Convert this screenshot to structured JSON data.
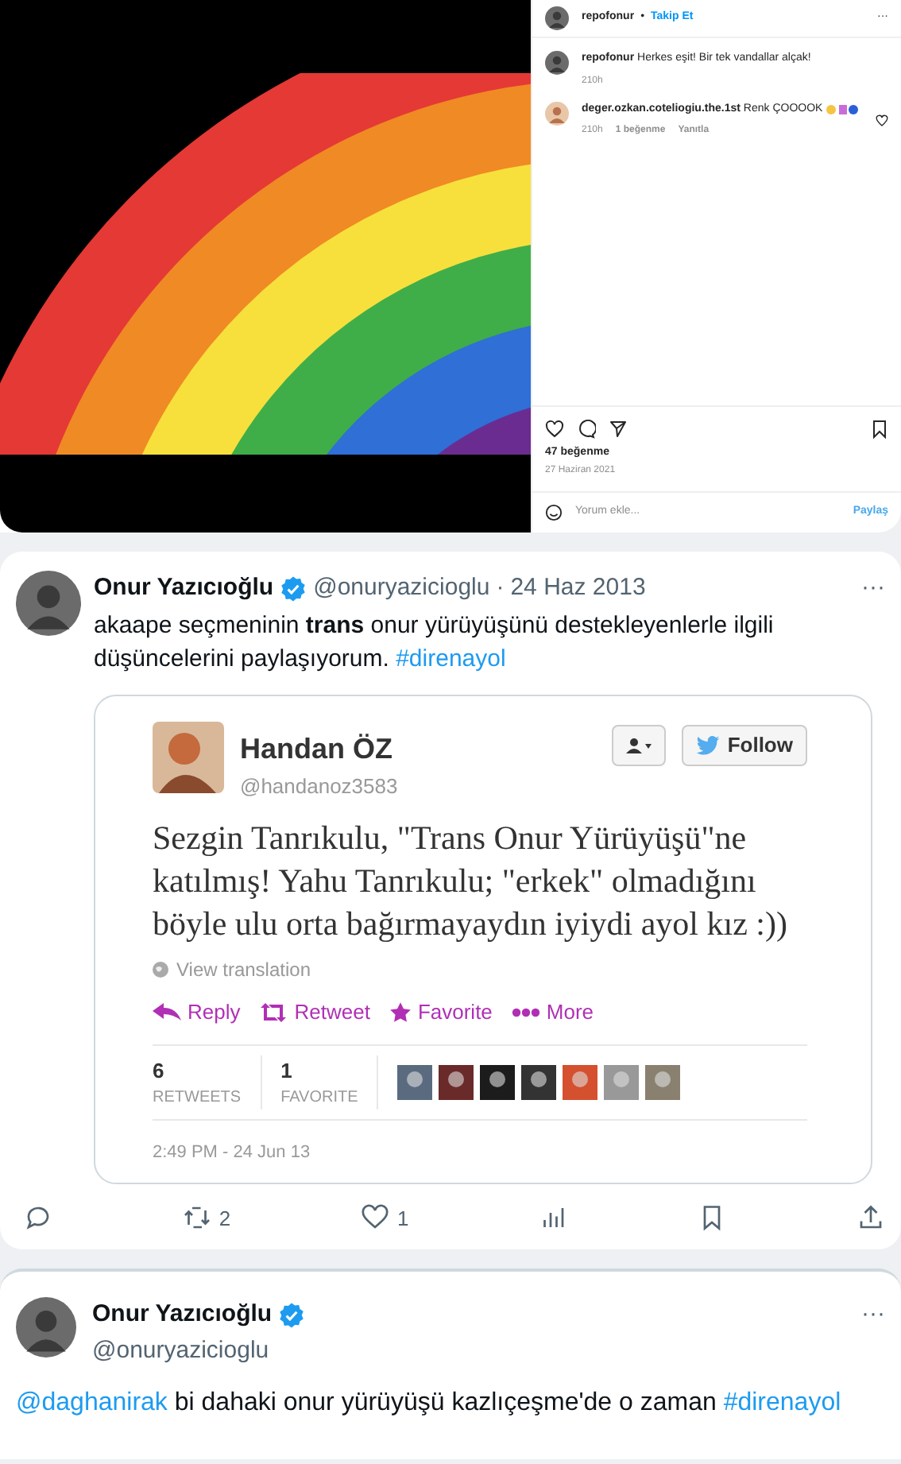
{
  "instagram_post": {
    "kind": "picture",
    "header": {
      "username": "repofonur",
      "separator": "•",
      "follow": "Takip Et",
      "more": "···"
    },
    "caption": {
      "username": "repofonur",
      "text": "Herkes eşit! Bir tek vandallar alçak!",
      "time": "210h"
    },
    "comments": [
      {
        "username": "deger.ozkan.coteliogiu.the.1st",
        "text": "Renk ÇOOOOK",
        "time": "210h",
        "likes": "1 beğenme",
        "reply": "Yanıtla",
        "liked": false
      }
    ],
    "likes": "47 beğenme",
    "date": "27 Haziran 2021",
    "saved": false,
    "comment_field": {
      "placeholder": "Yorum ekle...",
      "submit": "Paylaş"
    }
  },
  "tweet": {
    "name": "Onur Yazıcıoğlu",
    "verified": true,
    "handle": "@onuryazicioglu",
    "separator": "·",
    "date": "24 Haz 2013",
    "more": "···",
    "text": "akaape seçmeninin **trans** onur yürüyüşünü destekleyenlerle ilgili düşüncelerini paylaşıyorum.",
    "hashtag": "#direnayol",
    "embedded": {
      "name": "Handan ÖZ",
      "handle": "@handanoz3583",
      "follow": "Follow",
      "text": "Sezgin Tanrıkulu, \"Trans Onur Yürüyüşü\"ne katılmış! Yahu Tanrıkulu; \"erkek\" olmadığını böyle ulu orta bağırmayaydın iyiydi ayol kız :))",
      "translate": "View translation",
      "actions": [
        {
          "kind": "reply",
          "label": "Reply"
        },
        {
          "kind": "retweet",
          "label": "Retweet"
        },
        {
          "kind": "favorite",
          "label": "Favorite"
        },
        {
          "kind": "more",
          "label": "More"
        }
      ],
      "stats": [
        {
          "value": "6",
          "label": "RETWEETS"
        },
        {
          "value": "1",
          "label": "FAVORITE"
        }
      ],
      "timestamp": "2:49 PM - 24 Jun 13"
    },
    "actions": [
      {
        "kind": "reply"
      },
      {
        "kind": "retweet",
        "count": "2"
      },
      {
        "kind": "like",
        "count": "1"
      },
      {
        "kind": "views"
      },
      {
        "kind": "bookmark"
      },
      {
        "kind": "share"
      }
    ]
  },
  "reply_tweet": {
    "name": "Onur Yazıcıoğlu",
    "verified": true,
    "handle": "@onuryazicioglu",
    "more": "···",
    "mention": "@daghanirak",
    "text": "bi dahaki onur yürüyüşü kazlıçeşme'de o zaman",
    "hashtag": "#direnayol"
  }
}
